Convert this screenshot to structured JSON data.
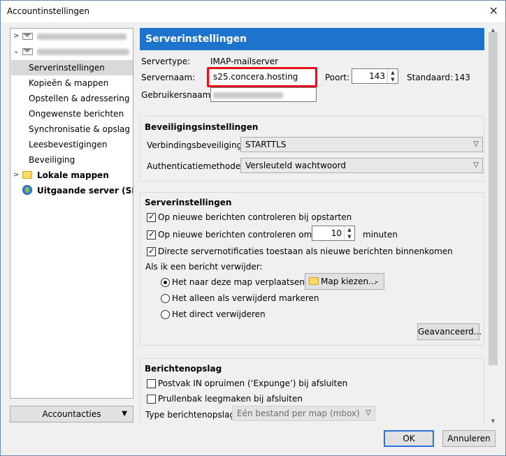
{
  "window": {
    "title": "Accountinstellingen",
    "close_glyph": "✕"
  },
  "tree": {
    "items": [
      {
        "label": "Serverinstellingen"
      },
      {
        "label": "Kopieën & mappen"
      },
      {
        "label": "Opstellen & adressering"
      },
      {
        "label": "Ongewenste berichten"
      },
      {
        "label": "Synchronisatie & opslag"
      },
      {
        "label": "Leesbevestigingen"
      },
      {
        "label": "Beveiliging"
      },
      {
        "label": "Lokale mappen"
      },
      {
        "label": "Uitgaande server (SM..."
      }
    ],
    "account_actions": "Accountacties"
  },
  "panel": {
    "header": "Serverinstellingen",
    "server_type_label": "Servertype:",
    "server_type_value": "IMAP-mailserver",
    "server_name_label": "Servernaam:",
    "server_name_value": "s25.concera.hosting",
    "port_label": "Poort:",
    "port_value": "143",
    "default_label": "Standaard:",
    "default_value": "143",
    "username_label": "Gebruikersnaam:"
  },
  "security": {
    "title": "Beveiligingsinstellingen",
    "connection_label": "Verbindingsbeveiliging:",
    "connection_value": "STARTTLS",
    "auth_label": "Authenticatiemethode:",
    "auth_value": "Versleuteld wachtwoord"
  },
  "server_settings": {
    "title": "Serverinstellingen",
    "check_startup": "Op nieuwe berichten controleren bij opstarten",
    "check_every": "Op nieuwe berichten controleren om de",
    "check_every_minutes": "10",
    "minutes_label": "minuten",
    "push_notifications": "Directe servernotificaties toestaan als nieuwe berichten binnenkomen",
    "on_delete_label": "Als ik een bericht verwijder:",
    "move_to_folder": "Het naar deze map verplaatsen:",
    "choose_folder": "Map kiezen...",
    "mark_deleted": "Het alleen als verwijderd markeren",
    "delete_immediately": "Het direct verwijderen",
    "advanced_button": "Geavanceerd..."
  },
  "storage": {
    "title": "Berichtenopslag",
    "expunge": "Postvak IN opruimen (‘Expunge’) bij afsluiten",
    "empty_trash": "Prullenbak leegmaken bij afsluiten",
    "storage_type_label": "Type berichtenopslag:",
    "storage_type_value": "Eén bestand per map (mbox)"
  },
  "footer": {
    "ok": "OK",
    "cancel": "Annuleren"
  }
}
